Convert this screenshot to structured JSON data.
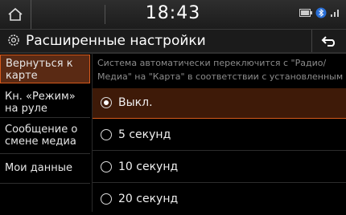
{
  "status": {
    "clock": "18:43",
    "icons": [
      "home-icon",
      "battery-icon",
      "bluetooth-icon",
      "signal-icon"
    ]
  },
  "header": {
    "title": "Расширенные настройки",
    "icon": "gear-icon",
    "back_icon": "back-arrow-icon"
  },
  "sidebar": {
    "items": [
      {
        "line1": "Вернуться к",
        "line2": "карте",
        "active": true
      },
      {
        "line1": "Кн. «Режим»",
        "line2": "на руле",
        "active": false
      },
      {
        "line1": "Сообщение о",
        "line2": "смене медиа",
        "active": false
      },
      {
        "line1": "Мои данные",
        "line2": "",
        "active": false
      }
    ]
  },
  "main": {
    "description_line1": "Система автоматически переключится с \"Радио/",
    "description_line2": "Медиа\" на \"Карта\" в соответствии с установленным",
    "options": [
      {
        "label": "Выкл.",
        "selected": true
      },
      {
        "label": "5 секунд",
        "selected": false
      },
      {
        "label": "10 секунд",
        "selected": false
      },
      {
        "label": "20 секунд",
        "selected": false
      }
    ]
  },
  "colors": {
    "accent": "#d65a1c",
    "active_bg": "#5a2a14",
    "selected_bg": "#3e1a08"
  }
}
